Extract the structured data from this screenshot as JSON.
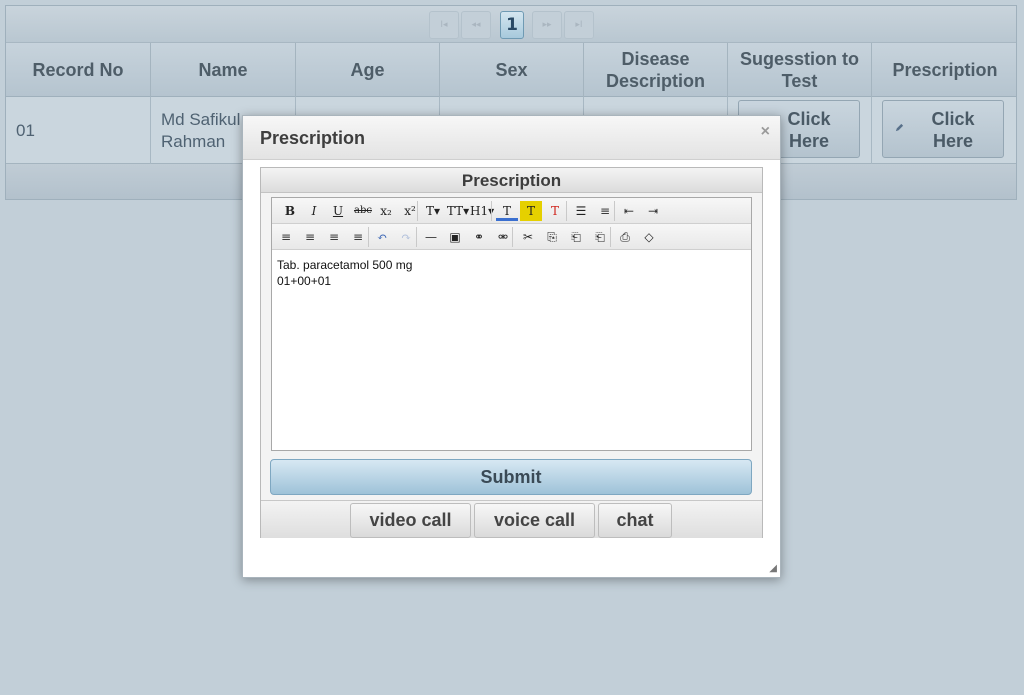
{
  "pager": {
    "first": "I◂",
    "prev": "◂◂",
    "current": "1",
    "next": "▸▸",
    "last": "▸I"
  },
  "table": {
    "columns": [
      "Record No",
      "Name",
      "Age",
      "Sex",
      "Disease Description",
      "Sugesstion to Test",
      "Prescription"
    ],
    "rows": [
      {
        "record_no": "01",
        "name": "Md Safikul Rahman",
        "suggestion_button": "Click Here",
        "prescription_button": "Click Here"
      }
    ]
  },
  "modal": {
    "title": "Prescription",
    "close": "×",
    "panel_title": "Prescription",
    "editor_lines": [
      "Tab. paracetamol 500 mg",
      "01+00+01"
    ],
    "submit": "Submit",
    "call_buttons": [
      "video call",
      "voice call",
      "chat"
    ]
  },
  "toolbar": {
    "row1": [
      {
        "glyph": "B",
        "name": "bold-icon"
      },
      {
        "glyph": "I",
        "name": "italic-icon"
      },
      {
        "glyph": "U",
        "name": "underline-icon"
      },
      {
        "glyph": "abc",
        "name": "strikethrough-icon"
      },
      {
        "glyph": "x₂",
        "name": "subscript-icon"
      },
      {
        "glyph": "x²",
        "name": "superscript-icon"
      },
      {
        "glyph": "T▾",
        "name": "font-family-icon"
      },
      {
        "glyph": "TT▾",
        "name": "font-size-icon"
      },
      {
        "glyph": "H1▾",
        "name": "heading-icon"
      },
      {
        "glyph": "T",
        "name": "text-color-icon"
      },
      {
        "glyph": "T",
        "name": "highlight-color-icon"
      },
      {
        "glyph": "T",
        "name": "remove-format-icon"
      },
      {
        "glyph": "☰",
        "name": "bulleted-list-icon"
      },
      {
        "glyph": "≡",
        "name": "numbered-list-icon"
      },
      {
        "glyph": "⇤",
        "name": "outdent-icon"
      },
      {
        "glyph": "⇥",
        "name": "indent-icon"
      }
    ],
    "row2": [
      {
        "glyph": "≡",
        "name": "align-left-icon"
      },
      {
        "glyph": "≡",
        "name": "align-center-icon"
      },
      {
        "glyph": "≡",
        "name": "align-right-icon"
      },
      {
        "glyph": "≡",
        "name": "justify-icon"
      },
      {
        "glyph": "↶",
        "name": "undo-icon"
      },
      {
        "glyph": "↷",
        "name": "redo-icon"
      },
      {
        "glyph": "—",
        "name": "horizontal-rule-icon"
      },
      {
        "glyph": "▣",
        "name": "image-icon"
      },
      {
        "glyph": "⚭",
        "name": "link-icon"
      },
      {
        "glyph": "⚮",
        "name": "unlink-icon"
      },
      {
        "glyph": "✂",
        "name": "cut-icon"
      },
      {
        "glyph": "⎘",
        "name": "copy-icon"
      },
      {
        "glyph": "⎗",
        "name": "paste-icon"
      },
      {
        "glyph": "⎗",
        "name": "paste-text-icon"
      },
      {
        "glyph": "⎙",
        "name": "print-icon"
      },
      {
        "glyph": "◇",
        "name": "source-code-icon"
      }
    ]
  },
  "colors": {
    "page_bg": "#c2cfd8",
    "header_text": "#4e5d68",
    "submit_bg": "#9ec2d8",
    "highlight": "#e5d000",
    "remove_format": "#d0261e"
  }
}
